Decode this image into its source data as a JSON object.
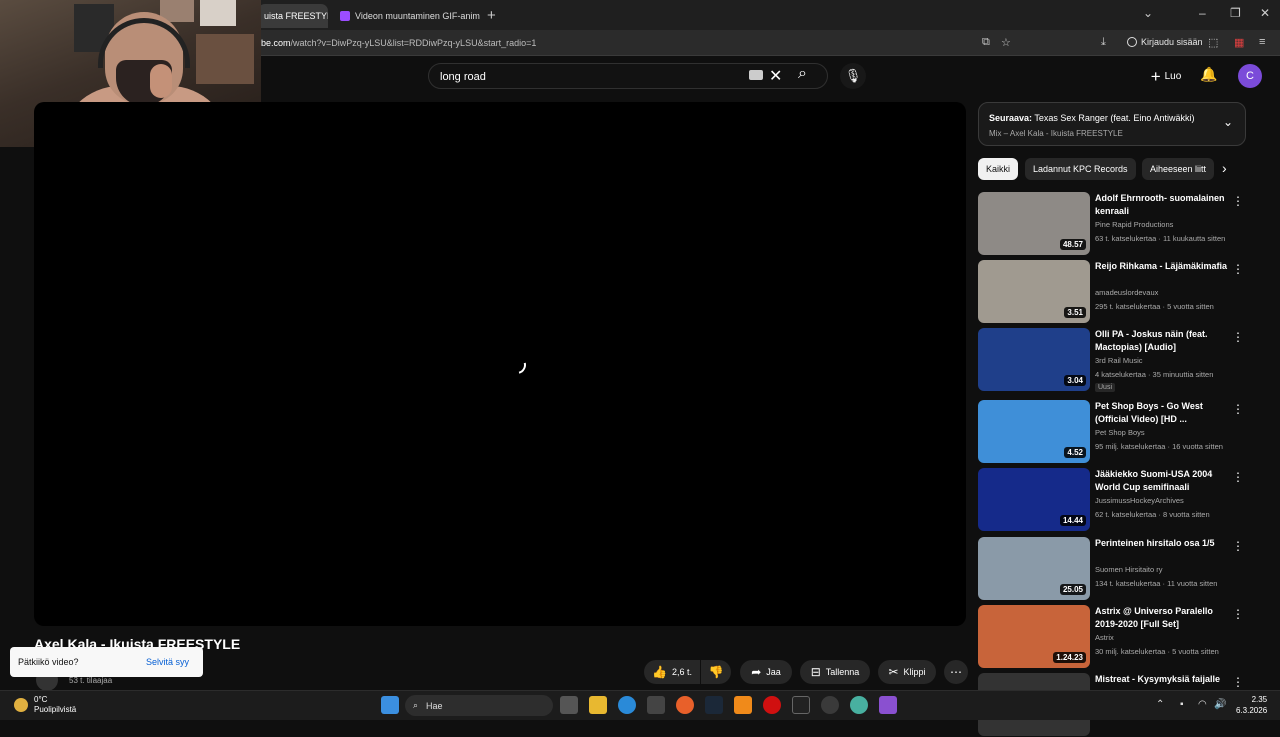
{
  "browser": {
    "tabs": [
      {
        "label": "uista FREESTYL"
      },
      {
        "label": "Videon muuntaminen GIF-anim"
      }
    ],
    "url_prefix": "be.com",
    "url_rest": "/watch?v=DiwPzq-yLSU&list=RDDiwPzq-yLSU&start_radio=1",
    "signin_label": "Kirjaudu sisään"
  },
  "header": {
    "search_value": "long road",
    "create_label": "Luo",
    "avatar_letter": "C"
  },
  "video": {
    "title": "Axel Kala - Ikuista FREESTYLE",
    "subscribers": "53 t. tilaajaa",
    "like_count": "2,6 t.",
    "share_label": "Jaa",
    "save_label": "Tallenna",
    "clip_label": "Klippi"
  },
  "toast": {
    "question": "Pätkiikö video?",
    "action": "Selvitä syy"
  },
  "upnext": {
    "prefix": "Seuraava:",
    "title": "Texas Sex Ranger (feat. Eino Antiwäkki)",
    "subtitle": "Mix – Axel Kala - Ikuista FREESTYLE"
  },
  "chips": [
    "Kaikki",
    "Ladannut KPC Records",
    "Aiheeseen liitt"
  ],
  "recommendations": [
    {
      "title": "Adolf Ehrnrooth- suomalainen kenraali",
      "channel": "Pine Rapid Productions",
      "meta": "63 t. katselukertaa · 11 kuukautta sitten",
      "duration": "48.57",
      "badge": "",
      "color": "#8e8a86"
    },
    {
      "title": "Reijo Rihkama - Läjämäkimafia",
      "channel": "amadeuslordevaux",
      "meta": "295 t. katselukertaa · 5 vuotta sitten",
      "duration": "3.51",
      "badge": "",
      "color": "#a09a90"
    },
    {
      "title": "Olli PA - Joskus näin (feat. Mactopias) [Audio]",
      "channel": "3rd Rail Music",
      "meta": "4 katselukertaa · 35 minuuttia sitten",
      "duration": "3.04",
      "badge": "Uusi",
      "color": "#1f3f8a"
    },
    {
      "title": "Pet Shop Boys - Go West (Official Video) [HD ...",
      "channel": "Pet Shop Boys",
      "meta": "95 milj. katselukertaa · 16 vuotta sitten",
      "duration": "4.52",
      "badge": "",
      "color": "#3f8fd8"
    },
    {
      "title": "Jääkiekko Suomi-USA 2004 World Cup semifinaali",
      "channel": "JussimussHockeyArchives",
      "meta": "62 t. katselukertaa · 8 vuotta sitten",
      "duration": "14.44",
      "badge": "",
      "color": "#152a8a"
    },
    {
      "title": "Perinteinen hirsitalo osa 1/5",
      "channel": "Suomen Hirsitaito ry",
      "meta": "134 t. katselukertaa · 11 vuotta sitten",
      "duration": "25.05",
      "badge": "",
      "color": "#8a9aa8"
    },
    {
      "title": "Astrix @ Universo Paralello 2019-2020 [Full Set]",
      "channel": "Astrix",
      "meta": "30 milj. katselukertaa · 5 vuotta sitten",
      "duration": "1.24.23",
      "badge": "",
      "color": "#c8643a"
    },
    {
      "title": "Mistreat - Kysymyksiä faijalle",
      "channel": "",
      "meta": "",
      "duration": "",
      "badge": "",
      "color": "#333333"
    }
  ],
  "taskbar": {
    "temp": "0°C",
    "weather": "Puolipilvistä",
    "search_label": "Hae",
    "time": "2.35",
    "date": "6.3.2026"
  }
}
